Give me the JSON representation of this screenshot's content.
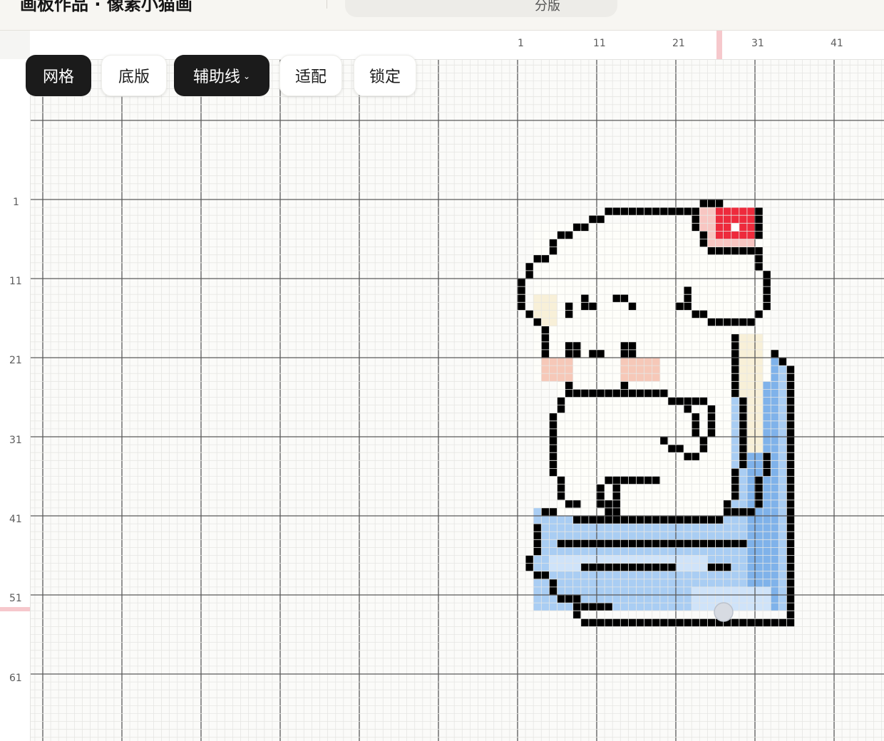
{
  "header": {
    "title": "画板作品 · 像素小猫画",
    "view_label": "分版"
  },
  "toolbar": {
    "grid_label": "网格",
    "base_label": "底版",
    "guides_label": "辅助线",
    "fit_label": "适配",
    "lock_label": "锁定"
  },
  "ruler": {
    "top_ticks": [
      "1",
      "11",
      "21",
      "31",
      "41"
    ],
    "left_ticks": [
      "1",
      "11",
      "21",
      "31",
      "41",
      "51",
      "61"
    ]
  },
  "colors": {
    "canvas_bg": "#fbfbf9",
    "major_grid": "#5a5a5a",
    "minor_grid": "#e6e6e3",
    "outline": "#000000",
    "body": "#fefefa",
    "body_shade": "#f8f0d8",
    "blush": "#f6c8b8",
    "heart": "#ee2a3c",
    "bow": "#f8c6c2",
    "blanket": "#a9cdf3",
    "blanket_dark": "#7fb2ea",
    "blanket_light": "#cfe3f9",
    "button": "#d7dbe2",
    "selection_marker": "#f6c8cc"
  }
}
